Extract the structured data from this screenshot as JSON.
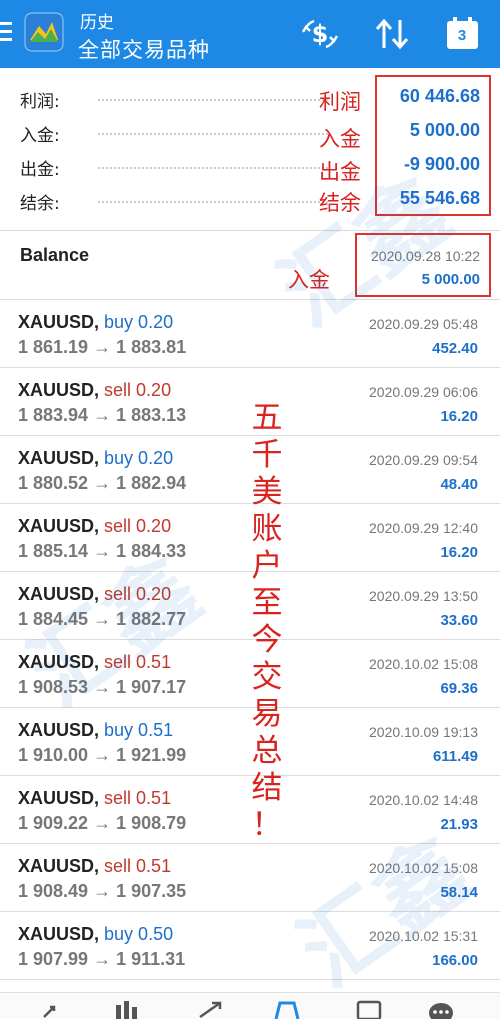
{
  "header": {
    "subtitle": "历史",
    "title": "全部交易品种",
    "calendar_day": "3",
    "icons": [
      "menu-icon",
      "app-logo-icon",
      "dollar-exchange-icon",
      "sort-arrows-icon",
      "calendar-icon"
    ]
  },
  "summary": [
    {
      "label": "利润:",
      "value": "60 446.68"
    },
    {
      "label": "入金:",
      "value": "5 000.00"
    },
    {
      "label": "出金:",
      "value": "-9 900.00"
    },
    {
      "label": "结余:",
      "value": "55 546.68"
    }
  ],
  "balance": {
    "title": "Balance",
    "time": "2020.09.28 10:22",
    "amount": "5 000.00"
  },
  "trades": [
    {
      "symbol": "XAUUSD,",
      "side": "buy 0.20",
      "dir": "buy",
      "prices": "1 861.19 → 1 883.81",
      "time": "2020.09.29 05:48",
      "profit": "452.40"
    },
    {
      "symbol": "XAUUSD,",
      "side": "sell 0.20",
      "dir": "sell",
      "prices": "1 883.94 → 1 883.13",
      "time": "2020.09.29 06:06",
      "profit": "16.20"
    },
    {
      "symbol": "XAUUSD,",
      "side": "buy 0.20",
      "dir": "buy",
      "prices": "1 880.52 → 1 882.94",
      "time": "2020.09.29 09:54",
      "profit": "48.40"
    },
    {
      "symbol": "XAUUSD,",
      "side": "sell 0.20",
      "dir": "sell",
      "prices": "1 885.14 → 1 884.33",
      "time": "2020.09.29 12:40",
      "profit": "16.20"
    },
    {
      "symbol": "XAUUSD,",
      "side": "sell 0.20",
      "dir": "sell",
      "prices": "1 884.45 → 1 882.77",
      "time": "2020.09.29 13:50",
      "profit": "33.60"
    },
    {
      "symbol": "XAUUSD,",
      "side": "sell 0.51",
      "dir": "sell",
      "prices": "1 908.53 → 1 907.17",
      "time": "2020.10.02 15:08",
      "profit": "69.36"
    },
    {
      "symbol": "XAUUSD,",
      "side": "buy 0.51",
      "dir": "buy",
      "prices": "1 910.00 → 1 921.99",
      "time": "2020.10.09 19:13",
      "profit": "611.49"
    },
    {
      "symbol": "XAUUSD,",
      "side": "sell 0.51",
      "dir": "sell",
      "prices": "1 909.22 → 1 908.79",
      "time": "2020.10.02 14:48",
      "profit": "21.93"
    },
    {
      "symbol": "XAUUSD,",
      "side": "sell 0.51",
      "dir": "sell",
      "prices": "1 908.49 → 1 907.35",
      "time": "2020.10.02 15:08",
      "profit": "58.14"
    },
    {
      "symbol": "XAUUSD,",
      "side": "buy 0.50",
      "dir": "buy",
      "prices": "1 907.99 → 1 911.31",
      "time": "2020.10.02 15:31",
      "profit": "166.00"
    }
  ],
  "annotations": {
    "profit": "利润",
    "deposit": "入金",
    "withdrawal": "出金",
    "balance": "结余",
    "balance_deposit": "入金",
    "vertical_text": [
      "五",
      "千",
      "美",
      "账",
      "户",
      "至",
      "今",
      "交",
      "易",
      "总",
      "结",
      "！"
    ],
    "color": "#d8231f"
  },
  "watermark": {
    "text": "汇鑫"
  },
  "colors": {
    "header": "#1e88e5",
    "value_blue": "#1e6fc9",
    "sell_red": "#c0392b"
  },
  "bottom_nav": [
    "quotes-icon",
    "chart-icon",
    "trade-icon",
    "history-icon",
    "news-icon",
    "chat-icon"
  ]
}
